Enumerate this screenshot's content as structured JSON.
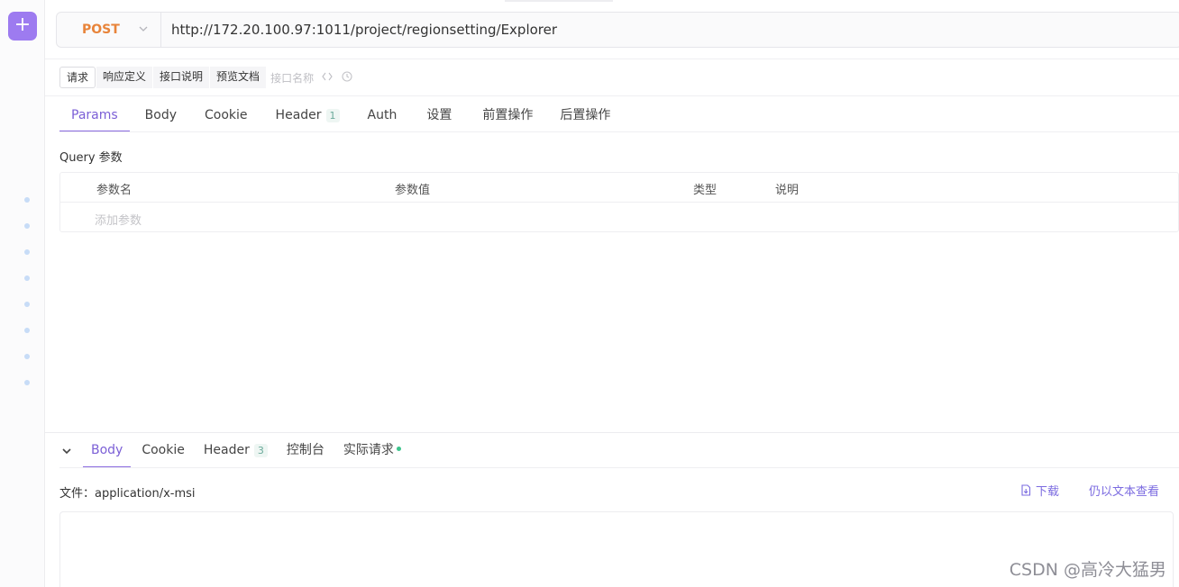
{
  "sidebar": {
    "add_label": "+",
    "dot_color": "#c7dcf7"
  },
  "request": {
    "method": "POST",
    "method_color": "#e8843a",
    "url": "http://172.20.100.97:1011/project/regionsetting/Explorer"
  },
  "subtabs": {
    "items": [
      "请求",
      "响应定义",
      "接口说明",
      "预览文档"
    ],
    "name_placeholder": "接口名称"
  },
  "tabs": {
    "items": [
      {
        "label": "Params",
        "badge": ""
      },
      {
        "label": "Body",
        "badge": ""
      },
      {
        "label": "Cookie",
        "badge": ""
      },
      {
        "label": "Header",
        "badge": "1"
      },
      {
        "label": "Auth",
        "badge": ""
      },
      {
        "label": "设置",
        "badge": ""
      },
      {
        "label": "前置操作",
        "badge": ""
      },
      {
        "label": "后置操作",
        "badge": ""
      }
    ],
    "active_color": "#7b5fd6"
  },
  "query": {
    "title": "Query 参数",
    "columns": [
      "参数名",
      "参数值",
      "类型",
      "说明"
    ],
    "add_row": "添加参数"
  },
  "response": {
    "tabs": [
      {
        "label": "Body",
        "badge": ""
      },
      {
        "label": "Cookie",
        "badge": ""
      },
      {
        "label": "Header",
        "badge": "3"
      },
      {
        "label": "控制台",
        "badge": ""
      },
      {
        "label": "实际请求",
        "badge": ""
      }
    ],
    "file_info": "文件：application/x-msi",
    "download": "下载",
    "view_as_text": "仍以文本查看"
  },
  "watermark": "CSDN @高冷大猛男"
}
